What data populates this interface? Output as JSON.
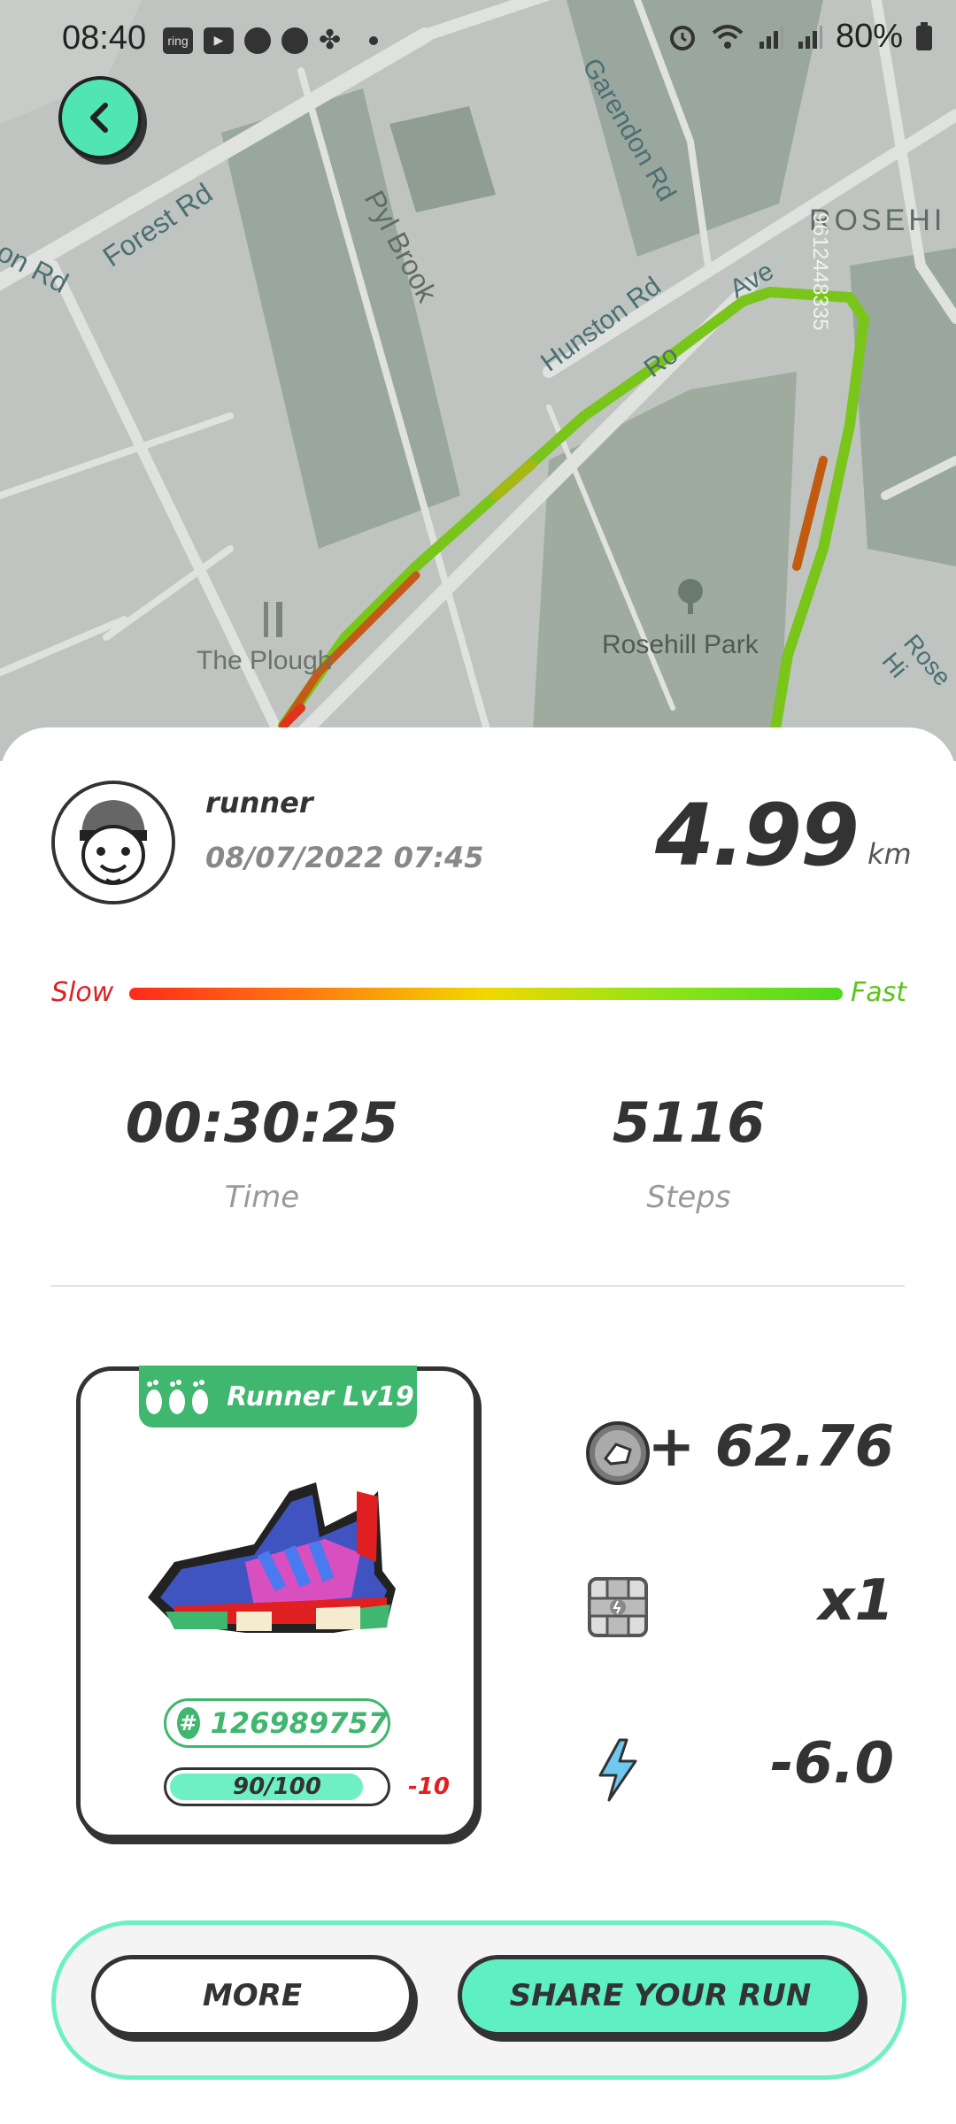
{
  "status_bar": {
    "time": "08:40",
    "left_icons": [
      "ring-app-icon",
      "youtube-icon",
      "bowl-icon",
      "bowl-icon",
      "fan-icon"
    ],
    "battery": "80%",
    "right_icons": [
      "alarm-icon",
      "wifi-icon",
      "signal-icon",
      "signal-icon",
      "battery-icon"
    ]
  },
  "map": {
    "labels": {
      "forest_rd": "Forest Rd",
      "on_rd": "on Rd",
      "pyl_brook": "Pyl Brook",
      "garendon_rd": "Garendon Rd",
      "hunston_rd": "Hunston Rd",
      "rosehill_short": "ROSEHI",
      "ave": "Ave",
      "ave_prefix": "Ro",
      "rosehill_park": "Rosehill Park",
      "the_plough": "The Plough",
      "rose_hi": "Rose Hi",
      "watermark": "9612448335"
    }
  },
  "run": {
    "username": "runner",
    "datetime": "08/07/2022 07:45",
    "distance": "4.99",
    "distance_unit": "km",
    "speed_slow": "Slow",
    "speed_fast": "Fast",
    "time_value": "00:30:25",
    "time_label": "Time",
    "steps_value": "5116",
    "steps_label": "Steps"
  },
  "shoe": {
    "level": "Runner Lv19",
    "id_symbol": "#",
    "id": "126989757",
    "durability_text": "90/100",
    "durability_fraction": 0.9,
    "durability_delta": "-10"
  },
  "rewards": {
    "gst": "+ 62.76",
    "mystery_box": "x1",
    "energy": "-6.0"
  },
  "buttons": {
    "more": "MORE",
    "share": "SHARE YOUR RUN"
  },
  "colors": {
    "accent": "#5ef0c2",
    "level_green": "#3fb76f",
    "slow_red": "#e02020",
    "fast_green": "#5cc41c"
  }
}
